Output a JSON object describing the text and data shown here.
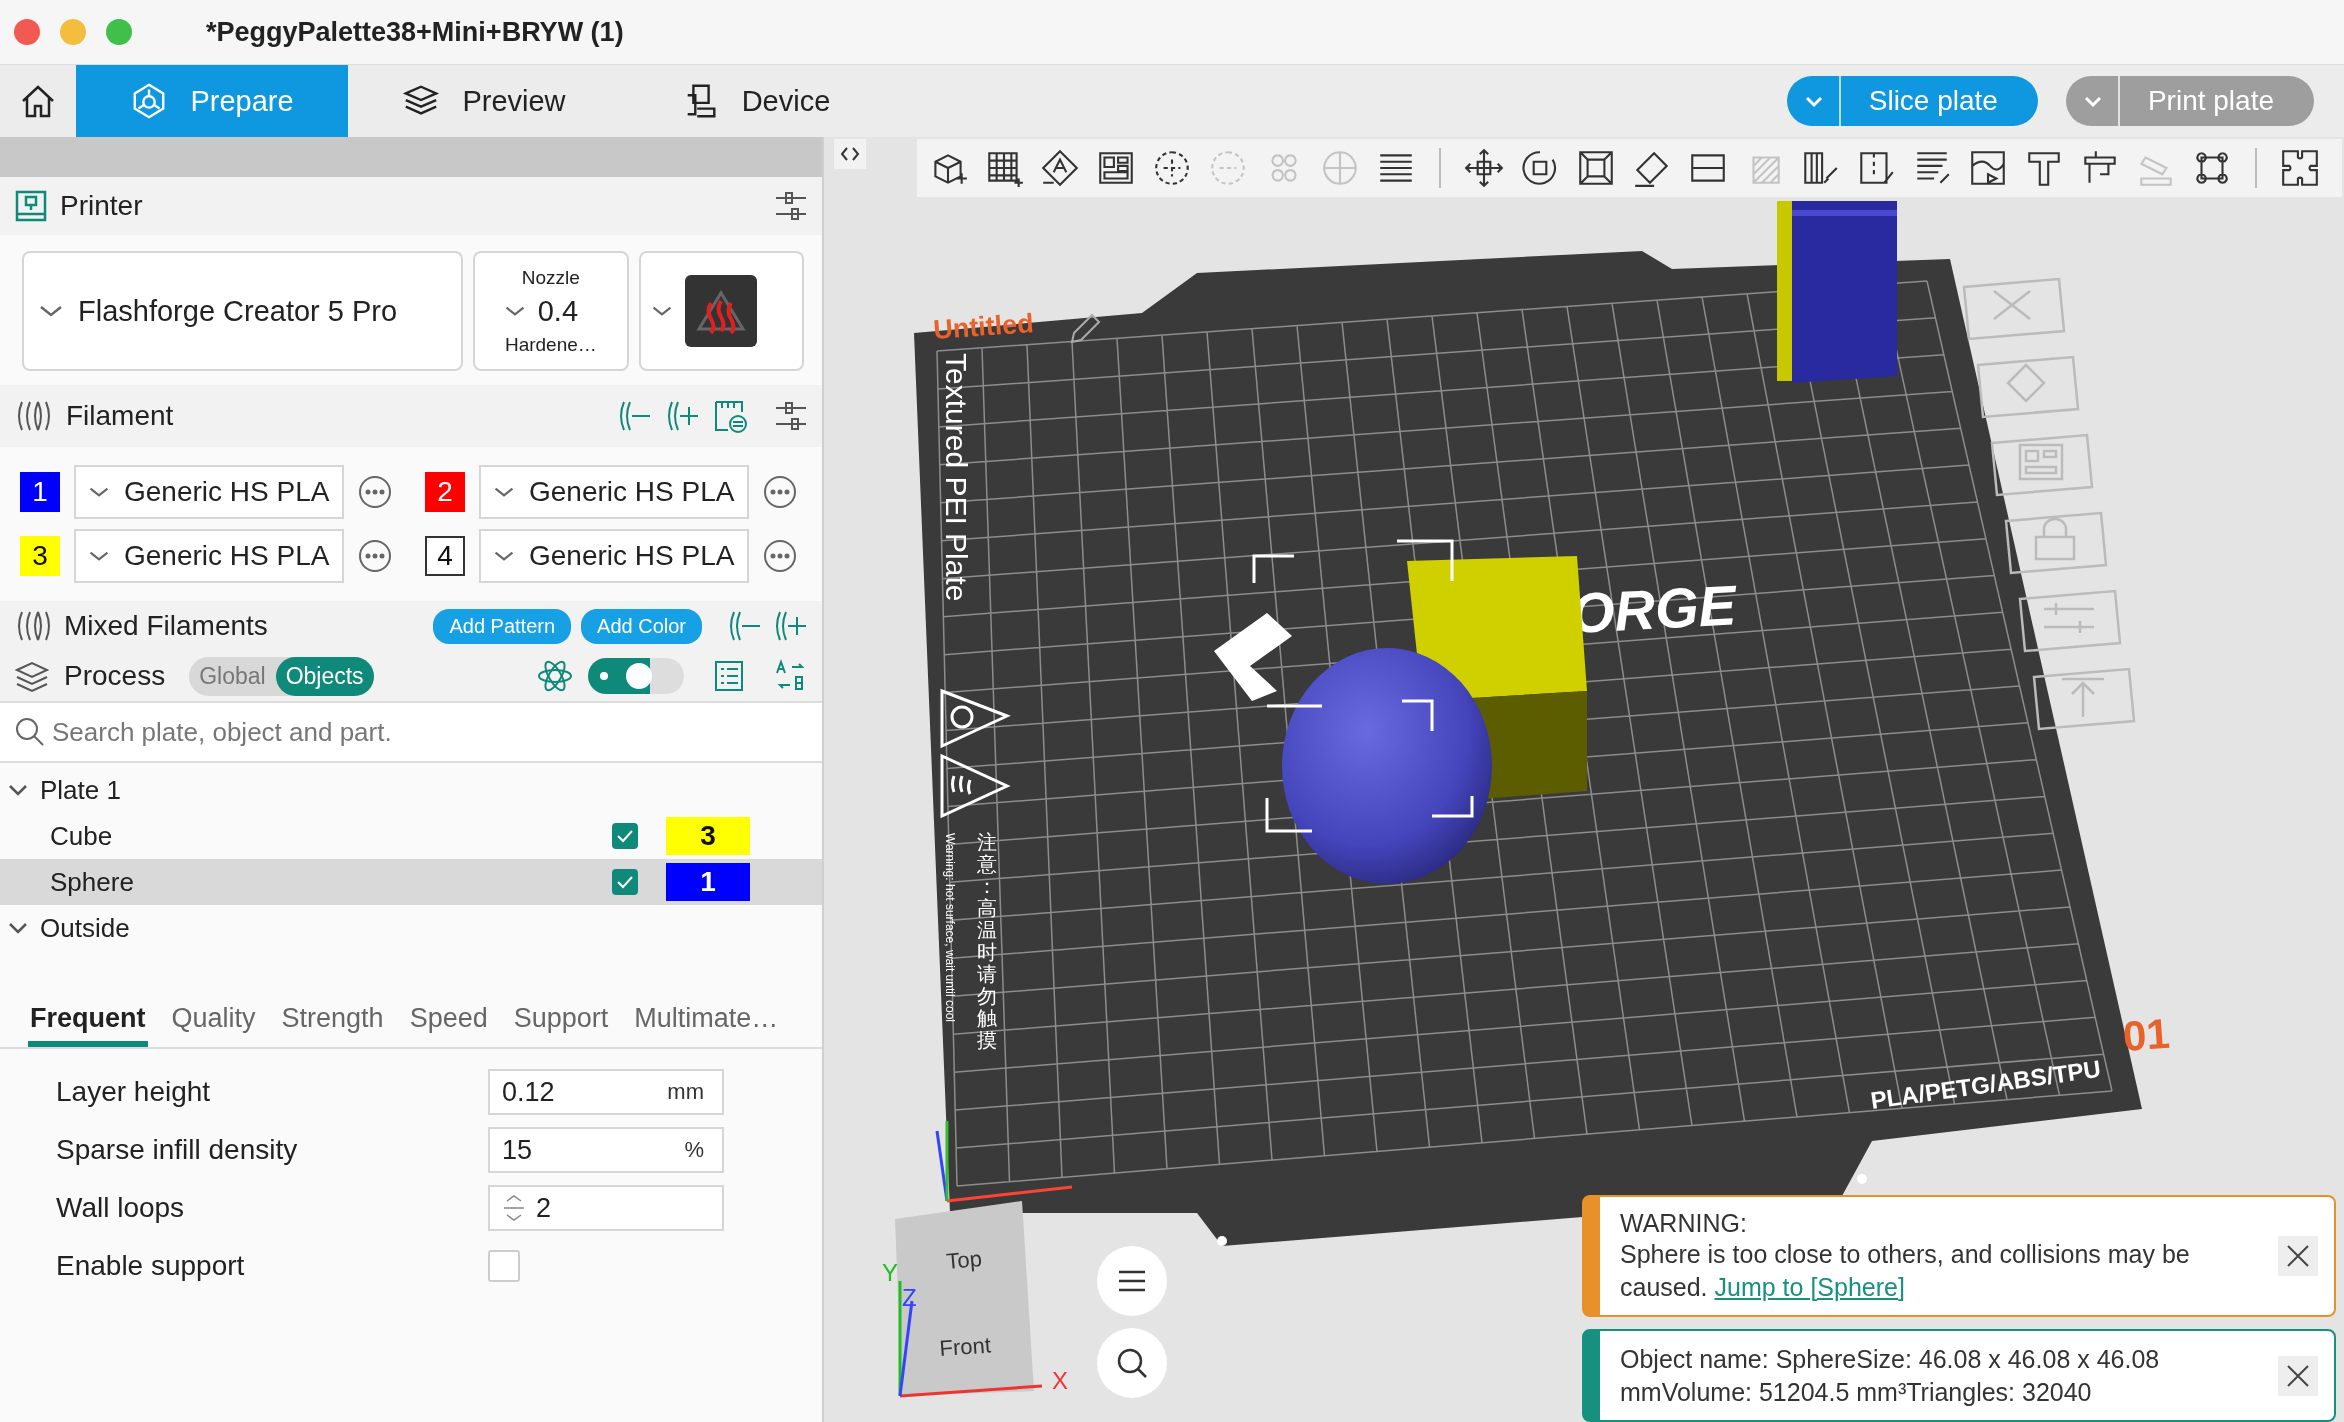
{
  "window": {
    "title": "*PeggyPalette38+Mini+BRYW (1)"
  },
  "nav": {
    "tabs": [
      {
        "label": "Prepare",
        "selected": true
      },
      {
        "label": "Preview",
        "selected": false
      },
      {
        "label": "Device",
        "selected": false
      }
    ],
    "buttons": [
      {
        "label": "Slice plate",
        "disabled": false
      },
      {
        "label": "Print plate",
        "disabled": true
      }
    ]
  },
  "printer": {
    "title": "Printer",
    "model": "Flashforge Creator 5 Pro",
    "nozzle_label": "Nozzle",
    "nozzle": "0.4",
    "nozzle_type": "Hardene…"
  },
  "filament": {
    "title": "Filament",
    "slots": [
      {
        "number": "1",
        "color": "#0000ff",
        "name": "Generic HS PLA"
      },
      {
        "number": "2",
        "color": "#ff0000",
        "name": "Generic HS PLA"
      },
      {
        "number": "3",
        "color": "#ffff00",
        "name": "Generic HS PLA"
      },
      {
        "number": "4",
        "color": "#ffffff",
        "name": "Generic HS PLA"
      }
    ]
  },
  "mixed": {
    "title": "Mixed Filaments",
    "buttons": [
      "Add Pattern",
      "Add Color"
    ]
  },
  "process": {
    "title": "Process",
    "modes": [
      {
        "label": "Global",
        "selected": false
      },
      {
        "label": "Objects",
        "selected": true
      }
    ],
    "toggle_on": true
  },
  "search": {
    "placeholder": "Search plate, object and part."
  },
  "tree": [
    {
      "label": "Plate 1",
      "expanded": true,
      "children": [
        {
          "label": "Cube",
          "checked": true,
          "selected": false,
          "filament": "3",
          "color": "#ffff00"
        },
        {
          "label": "Sphere",
          "checked": true,
          "selected": true,
          "filament": "1",
          "color": "#0000ff"
        }
      ]
    },
    {
      "label": "Outside",
      "expanded": true
    }
  ],
  "settings_tabs": [
    {
      "label": "Frequent",
      "selected": true
    },
    {
      "label": "Quality",
      "selected": false
    },
    {
      "label": "Strength",
      "selected": false
    },
    {
      "label": "Speed",
      "selected": false
    },
    {
      "label": "Support",
      "selected": false
    },
    {
      "label": "Multimate…",
      "selected": false
    }
  ],
  "settings": [
    {
      "kind": "unit",
      "label": "Layer height",
      "value": "0.12",
      "unit": "mm"
    },
    {
      "kind": "unit",
      "label": "Sparse infill density",
      "value": "15",
      "unit": "%"
    },
    {
      "kind": "spin",
      "label": "Wall loops",
      "value": "2"
    },
    {
      "kind": "checkbox",
      "label": "Enable support",
      "checked": false
    }
  ],
  "plate": {
    "name": "Untitled",
    "bed_type": "Textured PEI Plate",
    "logo": "ORGE",
    "caution_cn": "注意：高温时请勿触摸",
    "caution_en": "Warning: hot surface, wait until cool",
    "materials": "PLA/PETG/ABS/TPU",
    "number": "01"
  },
  "view_cube": {
    "top": "Top",
    "front": "Front",
    "axes": [
      "X",
      "Y",
      "Z"
    ]
  },
  "notifications": [
    {
      "kind": "warning",
      "title": "WARNING:",
      "text": "Sphere is too close to others, and collisions may be caused.",
      "link": "Jump to [Sphere]"
    },
    {
      "kind": "info",
      "text": "Object name: SphereSize: 46.08 x 46.08 x 46.08 mmVolume: 51204.5 mm³Triangles: 32040"
    }
  ]
}
